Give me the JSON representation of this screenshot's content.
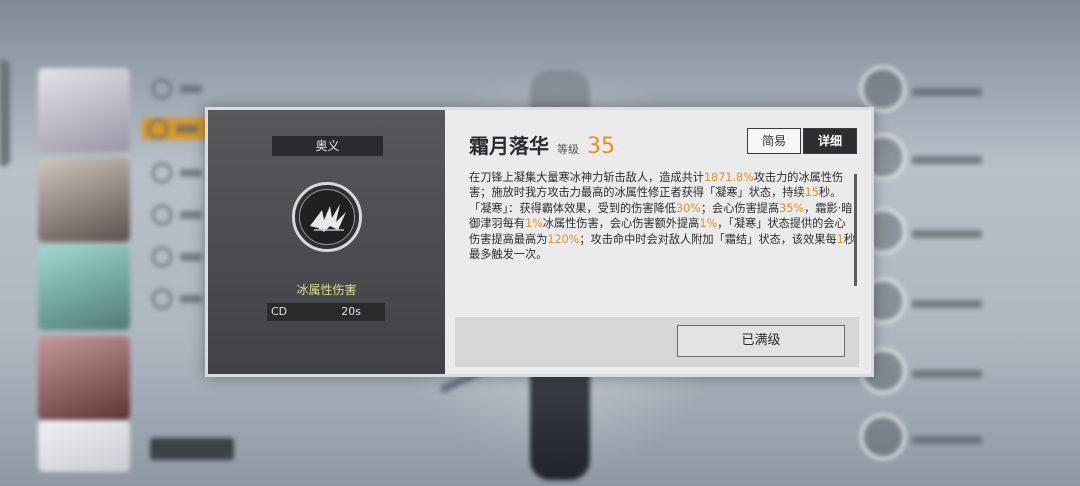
{
  "skill": {
    "category": "奥义",
    "damage_type": "冰属性伤害",
    "cd_label": "CD",
    "cd_value": "20s",
    "name": "霜月落华",
    "level_label": "等级",
    "level": "35"
  },
  "modes": {
    "simple_label": "简易",
    "detail_label": "详细",
    "active": "detail"
  },
  "description": {
    "p1": [
      "在刀锋上凝集大量寒冰神力斩击敌人，造成共计",
      "1871.8%",
      "攻击力的冰属性伤害；施放时我方攻击力最高的冰属性修正者获得「凝寒」状态，持续",
      "15",
      "秒。"
    ],
    "p2": [
      "「凝寒」：获得霸体效果，受到的伤害降低",
      "30%",
      "；会心伤害提高",
      "35%",
      "，霜影·暗御津羽每有",
      "1%",
      "冰属性伤害，会心伤害额外提高",
      "1%",
      "，「凝寒」状态提供的会心伤害提高最高为",
      "120%",
      "；攻击命中时会对敌人附加「霜结」状态，该效果每",
      "1",
      "秒最多触发一次。"
    ]
  },
  "footer": {
    "maxed_label": "已满级"
  },
  "colors": {
    "highlight": "#e88f1e",
    "damage_type": "#d8df8a",
    "modal_left": "#4b4d50",
    "modal_right": "#ebebec"
  }
}
